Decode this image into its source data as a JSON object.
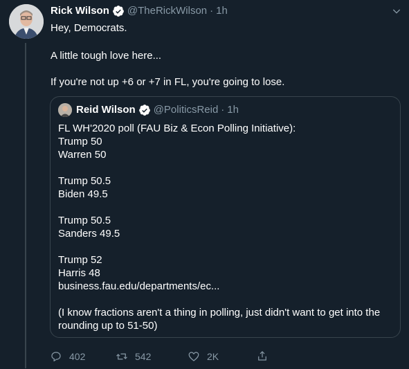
{
  "tweet": {
    "author_name": "Rick Wilson",
    "handle": "@TheRickWilson",
    "separator": "·",
    "time": "1h",
    "lines": [
      "Hey, Democrats.",
      "A little tough love here...",
      "If you're not up +6 or +7 in FL, you're going to lose."
    ]
  },
  "quote": {
    "author_name": "Reid Wilson",
    "handle": "@PoliticsReid",
    "separator": "·",
    "time": "1h",
    "lines": [
      "FL WH'2020 poll (FAU Biz & Econ Polling Initiative):",
      "Trump 50",
      "Warren 50",
      "",
      "Trump 50.5",
      "Biden 49.5",
      "",
      "Trump 50.5",
      "Sanders 49.5",
      "",
      "Trump 52",
      "Harris 48",
      "business.fau.edu/departments/ec...",
      "",
      "(I know fractions aren't a thing in polling, just didn't want to get into the",
      "rounding up to 51-50)"
    ]
  },
  "actions": {
    "replies": "402",
    "retweets": "542",
    "likes": "2K"
  },
  "icons": {
    "verified": "verified-badge-icon",
    "menu": "chevron-down-icon",
    "reply": "reply-icon",
    "retweet": "retweet-icon",
    "like": "heart-icon",
    "share": "share-icon"
  },
  "colors": {
    "background": "#15202b",
    "muted": "#8899a6",
    "border": "#38444d"
  }
}
